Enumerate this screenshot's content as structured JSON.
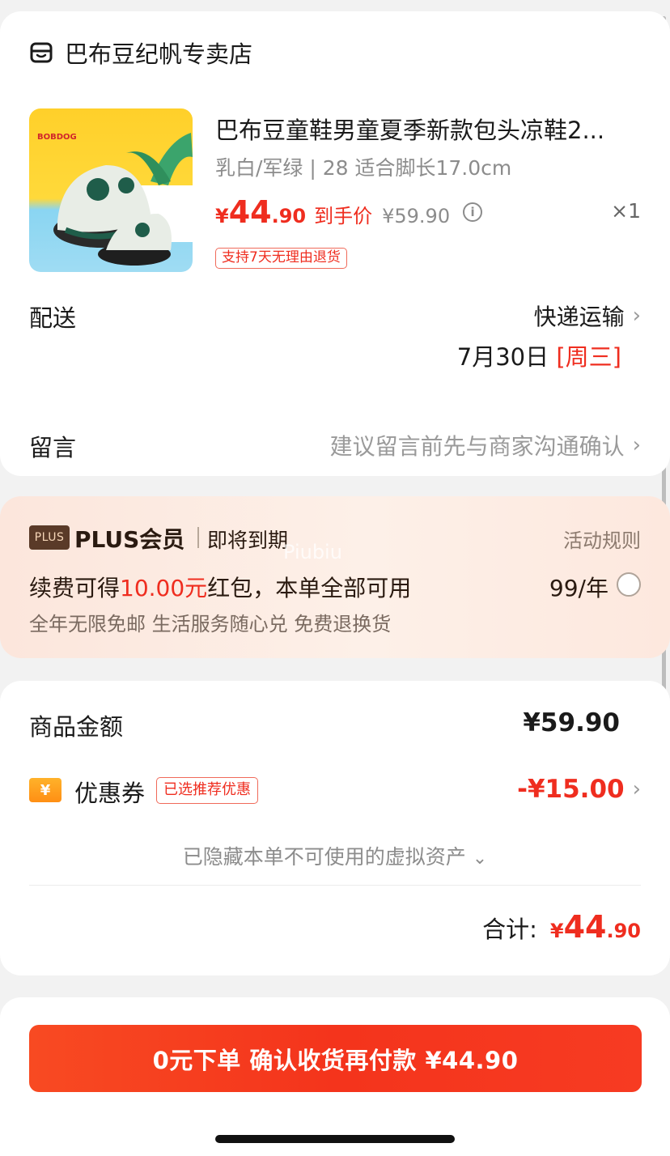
{
  "shop": {
    "store_icon": "storefront-icon",
    "store_name": "巴布豆纪帆专卖店",
    "product": {
      "brand_logo_text": "BOBDOG",
      "title": "巴布豆童鞋男童夏季新款包头凉鞋2...",
      "spec": "乳白/军绿 | 28 适合脚长17.0cm",
      "price_yen": "¥",
      "price_int": "44",
      "price_dec": ".90",
      "price_label": "到手价",
      "original_price": "¥59.90",
      "info_icon": "info-icon",
      "quantity": "×1",
      "return_tag": "支持7天无理由退货"
    },
    "delivery": {
      "label": "配送",
      "method": "快递运输",
      "date": "7月30日",
      "weekday": "[周三]"
    },
    "note": {
      "label": "留言",
      "hint": "建议留言前先与商家沟通确认"
    },
    "chevron": "›"
  },
  "plus": {
    "badge": "PLUS",
    "title": "PLUS会员",
    "status": "即将到期",
    "rules": "活动规则",
    "offer_prefix": "续费可得",
    "offer_amount": "10.00元",
    "offer_suffix": "红包，本单全部可用",
    "price": "99/年",
    "benefits": "全年无限免邮 生活服务随心兑 免费退换货",
    "watermark": "Piubiu",
    "selected": false
  },
  "amounts": {
    "goods_label": "商品金额",
    "goods_value": "¥59.90",
    "coupon_icon": "¥",
    "coupon_label": "优惠券",
    "coupon_tag": "已选推荐优惠",
    "coupon_value": "-¥15.00",
    "hidden_assets": "已隐藏本单不可使用的虚拟资产",
    "hidden_chevron": "⌄",
    "total_label": "合计:",
    "total_yen": "¥",
    "total_int": "44",
    "total_dec": ".90"
  },
  "footer": {
    "pay_button": "0元下单 确认收货再付款 ¥44.90"
  },
  "colors": {
    "accent_red": "#ef2d1f",
    "plus_bg": "#fce6dc",
    "button_orange": "#f4341c"
  }
}
